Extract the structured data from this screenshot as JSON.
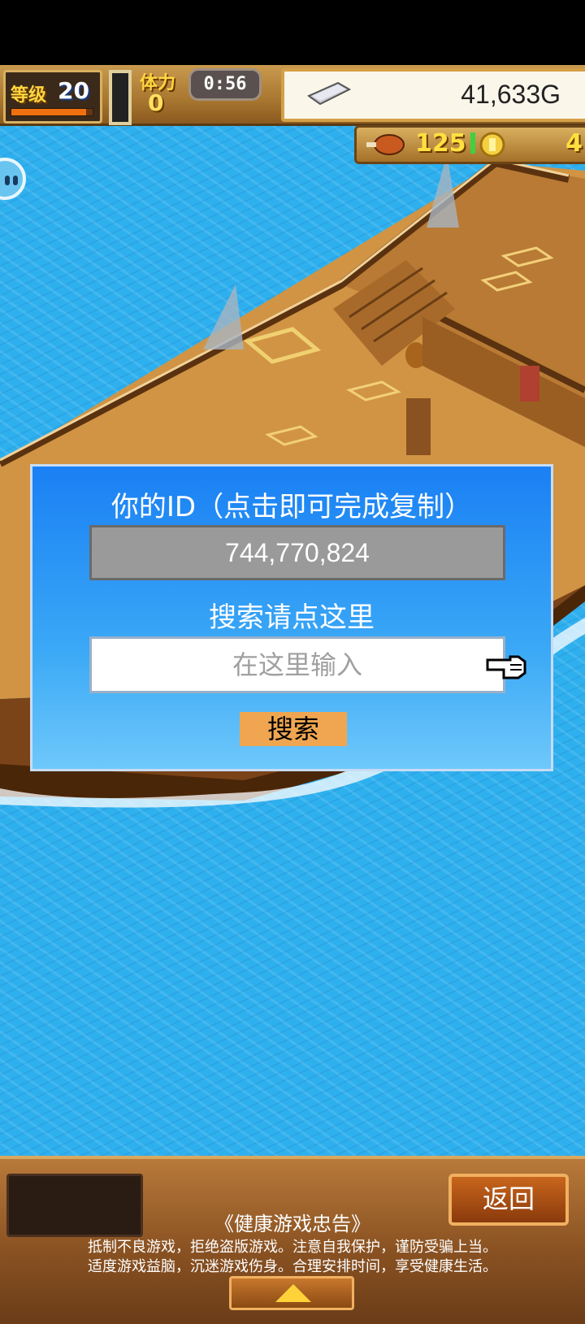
{
  "hud": {
    "level_label": "等级",
    "level_value": "20",
    "level_progress": 0.92,
    "stamina_label": "体力",
    "stamina_value": "0",
    "timer": "0:56",
    "gold": "41,633G",
    "meat": "125",
    "coins": "4"
  },
  "dialog": {
    "title": "你的ID（点击即可完成复制）",
    "user_id": "744,770,824",
    "search_hint": "搜索请点这里",
    "input_placeholder": "在这里输入",
    "search_button": "搜索"
  },
  "bottom": {
    "back_button": "返回",
    "notice_title": "《健康游戏忠告》",
    "notice_lines": [
      "抵制不良游戏，拒绝盗版游戏。注意自我保护，谨防受骗上当。",
      "适度游戏益脑，沉迷游戏伤身。合理安排时间，享受健康生活。"
    ]
  },
  "colors": {
    "sea": "#2fb0ee",
    "dialog_top": "#1a80f4",
    "dialog_bottom": "#6ec8fa",
    "search_button": "#f0a650",
    "id_box": "#9a9a9a"
  }
}
